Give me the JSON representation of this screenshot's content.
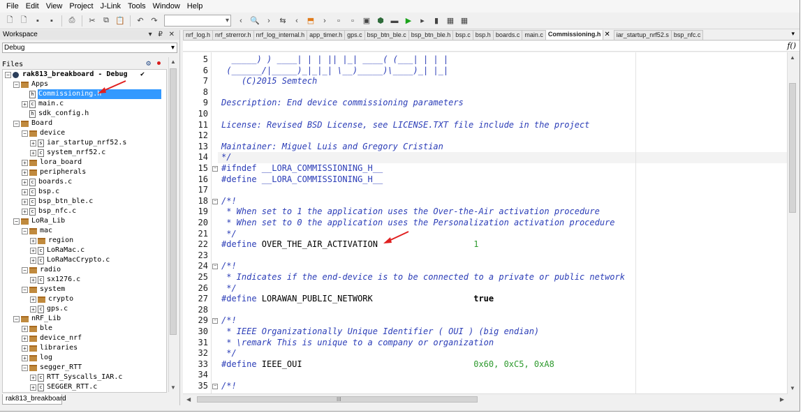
{
  "menu": [
    "File",
    "Edit",
    "View",
    "Project",
    "J-Link",
    "Tools",
    "Window",
    "Help"
  ],
  "toolbar": {
    "icons": [
      "new-file-icon",
      "new-project-icon",
      "save-icon",
      "save-all-icon",
      "print-icon",
      "cut-icon",
      "copy-icon",
      "paste-icon",
      "undo-icon",
      "redo-icon"
    ],
    "combo_value": "",
    "right_icons": [
      "back-icon",
      "search-icon",
      "forward-icon",
      "replace-icon",
      "navigate-back-icon",
      "bookmark-icon",
      "navigate-forward-icon",
      "file-nav-icon",
      "page-icon",
      "compile-icon",
      "build-icon",
      "make-icon",
      "debug-icon",
      "run-icon",
      "stop-icon",
      "debug-config-icon",
      "settings-icon"
    ]
  },
  "workspace": {
    "title": "Workspace",
    "pin_buttons": "▾ ₽ ✕",
    "config": "Debug",
    "files_label": "Files",
    "bottom_tab": "rak813_breakboard",
    "tree": [
      {
        "label": "rak813_breakboard - Debug",
        "depth": 0,
        "type": "project",
        "exp": "-",
        "check": "✔"
      },
      {
        "label": "Apps",
        "depth": 1,
        "type": "folder",
        "exp": "-"
      },
      {
        "label": "Commissioning.h",
        "depth": 2,
        "type": "file",
        "exp": "",
        "fileicon": "h",
        "selected": true
      },
      {
        "label": "main.c",
        "depth": 2,
        "type": "file",
        "exp": "+",
        "fileicon": "c"
      },
      {
        "label": "sdk_config.h",
        "depth": 2,
        "type": "file",
        "exp": "",
        "fileicon": "h"
      },
      {
        "label": "Board",
        "depth": 1,
        "type": "folder",
        "exp": "-"
      },
      {
        "label": "device",
        "depth": 2,
        "type": "folder",
        "exp": "-"
      },
      {
        "label": "iar_startup_nrf52.s",
        "depth": 3,
        "type": "file",
        "exp": "+",
        "fileicon": "s"
      },
      {
        "label": "system_nrf52.c",
        "depth": 3,
        "type": "file",
        "exp": "+",
        "fileicon": "c"
      },
      {
        "label": "lora_board",
        "depth": 2,
        "type": "folder",
        "exp": "+"
      },
      {
        "label": "peripherals",
        "depth": 2,
        "type": "folder",
        "exp": "+"
      },
      {
        "label": "boards.c",
        "depth": 2,
        "type": "file",
        "exp": "+",
        "fileicon": "c"
      },
      {
        "label": "bsp.c",
        "depth": 2,
        "type": "file",
        "exp": "+",
        "fileicon": "c"
      },
      {
        "label": "bsp_btn_ble.c",
        "depth": 2,
        "type": "file",
        "exp": "+",
        "fileicon": "c"
      },
      {
        "label": "bsp_nfc.c",
        "depth": 2,
        "type": "file",
        "exp": "+",
        "fileicon": "c"
      },
      {
        "label": "LoRa_Lib",
        "depth": 1,
        "type": "folder",
        "exp": "-"
      },
      {
        "label": "mac",
        "depth": 2,
        "type": "folder",
        "exp": "-"
      },
      {
        "label": "region",
        "depth": 3,
        "type": "folder",
        "exp": "+"
      },
      {
        "label": "LoRaMac.c",
        "depth": 3,
        "type": "file",
        "exp": "+",
        "fileicon": "c"
      },
      {
        "label": "LoRaMacCrypto.c",
        "depth": 3,
        "type": "file",
        "exp": "+",
        "fileicon": "c"
      },
      {
        "label": "radio",
        "depth": 2,
        "type": "folder",
        "exp": "-"
      },
      {
        "label": "sx1276.c",
        "depth": 3,
        "type": "file",
        "exp": "+",
        "fileicon": "c"
      },
      {
        "label": "system",
        "depth": 2,
        "type": "folder",
        "exp": "-"
      },
      {
        "label": "crypto",
        "depth": 3,
        "type": "folder",
        "exp": "+"
      },
      {
        "label": "gps.c",
        "depth": 3,
        "type": "file",
        "exp": "+",
        "fileicon": "c"
      },
      {
        "label": "nRF_Lib",
        "depth": 1,
        "type": "folder",
        "exp": "-"
      },
      {
        "label": "ble",
        "depth": 2,
        "type": "folder",
        "exp": "+"
      },
      {
        "label": "device_nrf",
        "depth": 2,
        "type": "folder",
        "exp": "+"
      },
      {
        "label": "libraries",
        "depth": 2,
        "type": "folder",
        "exp": "+"
      },
      {
        "label": "log",
        "depth": 2,
        "type": "folder",
        "exp": "+"
      },
      {
        "label": "segger_RTT",
        "depth": 2,
        "type": "folder",
        "exp": "-"
      },
      {
        "label": "RTT_Syscalls_IAR.c",
        "depth": 3,
        "type": "file",
        "exp": "+",
        "fileicon": "c"
      },
      {
        "label": "SEGGER_RTT.c",
        "depth": 3,
        "type": "file",
        "exp": "+",
        "fileicon": "c"
      }
    ]
  },
  "tabs": [
    {
      "label": "nrf_log.h",
      "active": false
    },
    {
      "label": "nrf_strerror.h",
      "active": false
    },
    {
      "label": "nrf_log_internal.h",
      "active": false
    },
    {
      "label": "app_timer.h",
      "active": false
    },
    {
      "label": "gps.c",
      "active": false
    },
    {
      "label": "bsp_btn_ble.c",
      "active": false
    },
    {
      "label": "bsp_btn_ble.h",
      "active": false
    },
    {
      "label": "bsp.c",
      "active": false
    },
    {
      "label": "bsp.h",
      "active": false
    },
    {
      "label": "boards.c",
      "active": false
    },
    {
      "label": "main.c",
      "active": false
    },
    {
      "label": "Commissioning.h",
      "active": true
    },
    {
      "label": "iar_startup_nrf52.s",
      "active": false
    },
    {
      "label": "bsp_nfc.c",
      "active": false
    }
  ],
  "tab_close": "✕",
  "tab_menu": "▾",
  "funcbar_label": "f()",
  "code": [
    {
      "n": "5",
      "fold": "",
      "parts": [
        [
          "c-comment",
          "  _____) ) ____| | | || |_| ____( (___| | | |"
        ]
      ]
    },
    {
      "n": "6",
      "fold": "",
      "parts": [
        [
          "c-comment",
          " (______/|_____)_|_|_| \\__)_____)\\____)_| |_|"
        ]
      ]
    },
    {
      "n": "7",
      "fold": "",
      "parts": [
        [
          "c-comment",
          "    (C)2015 Semtech"
        ]
      ]
    },
    {
      "n": "8",
      "fold": "",
      "parts": []
    },
    {
      "n": "9",
      "fold": "",
      "parts": [
        [
          "c-comment",
          "Description: End device commissioning parameters"
        ]
      ]
    },
    {
      "n": "10",
      "fold": "",
      "parts": []
    },
    {
      "n": "11",
      "fold": "",
      "parts": [
        [
          "c-comment",
          "License: Revised BSD License, see LICENSE.TXT file include in the project"
        ]
      ]
    },
    {
      "n": "12",
      "fold": "",
      "parts": []
    },
    {
      "n": "13",
      "fold": "",
      "parts": [
        [
          "c-comment",
          "Maintainer: Miguel Luis and Gregory Cristian"
        ]
      ]
    },
    {
      "n": "14",
      "fold": "",
      "parts": [
        [
          "c-comment",
          "*/"
        ]
      ]
    },
    {
      "n": "15",
      "fold": "-",
      "parts": [
        [
          "c-pp",
          "#ifndef __LORA_COMMISSIONING_H__"
        ]
      ]
    },
    {
      "n": "16",
      "fold": "",
      "parts": [
        [
          "c-pp",
          "#define __LORA_COMMISSIONING_H__"
        ]
      ]
    },
    {
      "n": "17",
      "fold": "",
      "parts": []
    },
    {
      "n": "18",
      "fold": "-",
      "parts": [
        [
          "c-comment",
          "/*!"
        ]
      ]
    },
    {
      "n": "19",
      "fold": "",
      "parts": [
        [
          "c-comment",
          " * When set to 1 the application uses the Over-the-Air activation procedure"
        ]
      ]
    },
    {
      "n": "20",
      "fold": "",
      "parts": [
        [
          "c-comment",
          " * When set to 0 the application uses the Personalization activation procedure"
        ]
      ]
    },
    {
      "n": "21",
      "fold": "",
      "parts": [
        [
          "c-comment",
          " */"
        ]
      ]
    },
    {
      "n": "22",
      "fold": "",
      "parts": [
        [
          "c-pp",
          "#define "
        ],
        [
          "c-def",
          "OVER_THE_AIR_ACTIVATION                   "
        ],
        [
          "c-num",
          "1"
        ]
      ]
    },
    {
      "n": "23",
      "fold": "",
      "parts": []
    },
    {
      "n": "24",
      "fold": "-",
      "parts": [
        [
          "c-comment",
          "/*!"
        ]
      ]
    },
    {
      "n": "25",
      "fold": "",
      "parts": [
        [
          "c-comment",
          " * Indicates if the end-device is to be connected to a private or public network"
        ]
      ]
    },
    {
      "n": "26",
      "fold": "",
      "parts": [
        [
          "c-comment",
          " */"
        ]
      ]
    },
    {
      "n": "27",
      "fold": "",
      "parts": [
        [
          "c-pp",
          "#define "
        ],
        [
          "c-def",
          "LORAWAN_PUBLIC_NETWORK                    "
        ],
        [
          "c-kw",
          "true"
        ]
      ]
    },
    {
      "n": "28",
      "fold": "",
      "parts": []
    },
    {
      "n": "29",
      "fold": "-",
      "parts": [
        [
          "c-comment",
          "/*!"
        ]
      ]
    },
    {
      "n": "30",
      "fold": "",
      "parts": [
        [
          "c-comment",
          " * IEEE Organizationally Unique Identifier ( OUI ) (big endian)"
        ]
      ]
    },
    {
      "n": "31",
      "fold": "",
      "parts": [
        [
          "c-comment",
          " * \\remark This is unique to a company or organization"
        ]
      ]
    },
    {
      "n": "32",
      "fold": "",
      "parts": [
        [
          "c-comment",
          " */"
        ]
      ]
    },
    {
      "n": "33",
      "fold": "",
      "parts": [
        [
          "c-pp",
          "#define "
        ],
        [
          "c-def",
          "IEEE_OUI                                  "
        ],
        [
          "c-num",
          "0x60, 0xC5, 0xA8"
        ]
      ]
    },
    {
      "n": "34",
      "fold": "",
      "parts": []
    },
    {
      "n": "35",
      "fold": "-",
      "parts": [
        [
          "c-comment",
          "/*!"
        ]
      ]
    }
  ],
  "colors": {
    "comment": "#2b3db7",
    "number": "#2e9a2e",
    "selection": "#3399ff",
    "arrow": "#e02020"
  }
}
